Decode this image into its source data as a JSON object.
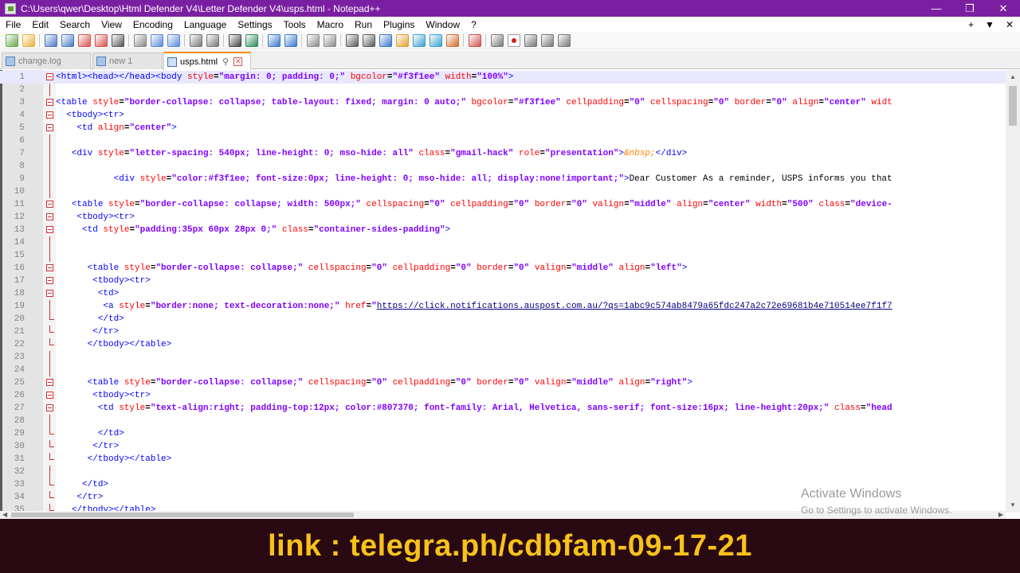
{
  "window": {
    "title": "C:\\Users\\qwer\\Desktop\\Html Defender V4\\Letter Defender V4\\usps.html - Notepad++",
    "controls": [
      "—",
      "❐",
      "✕"
    ]
  },
  "menu": {
    "items": [
      "File",
      "Edit",
      "Search",
      "View",
      "Encoding",
      "Language",
      "Settings",
      "Tools",
      "Macro",
      "Run",
      "Plugins",
      "Window",
      "?"
    ],
    "right": [
      "+",
      "▼",
      "✕"
    ]
  },
  "toolbar": {
    "icons": [
      "new-file-icon",
      "open-file-icon",
      "save-icon",
      "save-all-icon",
      "close-icon",
      "close-all-icon",
      "print-icon",
      "cut-icon",
      "copy-icon",
      "paste-icon",
      "undo-icon",
      "redo-icon",
      "find-icon",
      "replace-icon",
      "zoom-in-icon",
      "zoom-out-icon",
      "sync-vertical-icon",
      "sync-horizontal-icon",
      "word-wrap-icon",
      "show-all-chars-icon",
      "indent-guide-icon",
      "user-lang-icon",
      "doc-map-icon",
      "function-list-icon",
      "folder-workspace-icon",
      "monitoring-icon",
      "record-macro-icon",
      "stop-record-icon",
      "play-macro-icon",
      "run-macro-multiple-icon",
      "save-macro-icon"
    ]
  },
  "tabs": [
    {
      "label": "change.log",
      "active": false
    },
    {
      "label": "new 1",
      "active": false
    },
    {
      "label": "usps.html",
      "active": true
    }
  ],
  "editor": {
    "lines": [
      {
        "n": "1",
        "fold": "box",
        "html": "<span class='t'>&lt;html&gt;&lt;head&gt;&lt;/head&gt;&lt;body </span><span class='a'>style</span><span class='x'>=</span><span class='v'>\"margin: 0; padding: 0;\"</span><span class='t'> </span><span class='a'>bgcolor</span><span class='x'>=</span><span class='v'>\"#f3f1ee\"</span><span class='t'> </span><span class='a'>width</span><span class='x'>=</span><span class='v'>\"100%\"</span><span class='t'>&gt;</span>"
      },
      {
        "n": "2",
        "fold": "line",
        "html": ""
      },
      {
        "n": "3",
        "fold": "box",
        "html": "<span class='t'>&lt;table </span><span class='a'>style</span><span class='x'>=</span><span class='v'>\"border-collapse: collapse; table-layout: fixed; margin: 0 auto;\"</span><span class='t'> </span><span class='a'>bgcolor</span><span class='x'>=</span><span class='v'>\"#f3f1ee\"</span><span class='t'> </span><span class='a'>cellpadding</span><span class='x'>=</span><span class='v'>\"0\"</span><span class='t'> </span><span class='a'>cellspacing</span><span class='x'>=</span><span class='v'>\"0\"</span><span class='t'> </span><span class='a'>border</span><span class='x'>=</span><span class='v'>\"0\"</span><span class='t'> </span><span class='a'>align</span><span class='x'>=</span><span class='v'>\"center\"</span><span class='t'> </span><span class='a'>widt</span>"
      },
      {
        "n": "4",
        "fold": "box",
        "html": "  <span class='t'>&lt;tbody&gt;&lt;tr&gt;</span>"
      },
      {
        "n": "5",
        "fold": "box",
        "html": "    <span class='t'>&lt;td </span><span class='a'>align</span><span class='x'>=</span><span class='v'>\"center\"</span><span class='t'>&gt;</span>"
      },
      {
        "n": "6",
        "fold": "line",
        "html": ""
      },
      {
        "n": "7",
        "fold": "line",
        "html": "   <span class='t'>&lt;div </span><span class='a'>style</span><span class='x'>=</span><span class='v'>\"letter-spacing: 540px; line-height: 0; mso-hide: all\"</span><span class='t'> </span><span class='a'>class</span><span class='x'>=</span><span class='v'>\"gmail-hack\"</span><span class='t'> </span><span class='a'>role</span><span class='x'>=</span><span class='v'>\"presentation\"</span><span class='t'>&gt;</span><span class='e'>&amp;nbsp;</span><span class='t'>&lt;/div&gt;</span>"
      },
      {
        "n": "8",
        "fold": "line",
        "html": ""
      },
      {
        "n": "9",
        "fold": "line",
        "html": "           <span class='t'>&lt;div </span><span class='a'>style</span><span class='x'>=</span><span class='v'>\"color:#f3f1ee; font-size:0px; line-height: 0; mso-hide: all; display:none!important;\"</span><span class='t'>&gt;</span>Dear Customer As a reminder, USPS informs you that"
      },
      {
        "n": "10",
        "fold": "line",
        "html": ""
      },
      {
        "n": "11",
        "fold": "box",
        "html": "   <span class='t'>&lt;table </span><span class='a'>style</span><span class='x'>=</span><span class='v'>\"border-collapse: collapse; width: 500px;\"</span><span class='t'> </span><span class='a'>cellspacing</span><span class='x'>=</span><span class='v'>\"0\"</span><span class='t'> </span><span class='a'>cellpadding</span><span class='x'>=</span><span class='v'>\"0\"</span><span class='t'> </span><span class='a'>border</span><span class='x'>=</span><span class='v'>\"0\"</span><span class='t'> </span><span class='a'>valign</span><span class='x'>=</span><span class='v'>\"middle\"</span><span class='t'> </span><span class='a'>align</span><span class='x'>=</span><span class='v'>\"center\"</span><span class='t'> </span><span class='a'>width</span><span class='x'>=</span><span class='v'>\"500\"</span><span class='t'> </span><span class='a'>class</span><span class='x'>=</span><span class='v'>\"device-</span>"
      },
      {
        "n": "12",
        "fold": "box",
        "html": "    <span class='t'>&lt;tbody&gt;&lt;tr&gt;</span>"
      },
      {
        "n": "13",
        "fold": "box",
        "html": "     <span class='t'>&lt;td </span><span class='a'>style</span><span class='x'>=</span><span class='v'>\"padding:35px 60px 28px 0;\"</span><span class='t'> </span><span class='a'>class</span><span class='x'>=</span><span class='v'>\"container-sides-padding\"</span><span class='t'>&gt;</span>"
      },
      {
        "n": "14",
        "fold": "line",
        "html": ""
      },
      {
        "n": "15",
        "fold": "line",
        "html": ""
      },
      {
        "n": "16",
        "fold": "box",
        "html": "      <span class='t'>&lt;table </span><span class='a'>style</span><span class='x'>=</span><span class='v'>\"border-collapse: collapse;\"</span><span class='t'> </span><span class='a'>cellspacing</span><span class='x'>=</span><span class='v'>\"0\"</span><span class='t'> </span><span class='a'>cellpadding</span><span class='x'>=</span><span class='v'>\"0\"</span><span class='t'> </span><span class='a'>border</span><span class='x'>=</span><span class='v'>\"0\"</span><span class='t'> </span><span class='a'>valign</span><span class='x'>=</span><span class='v'>\"middle\"</span><span class='t'> </span><span class='a'>align</span><span class='x'>=</span><span class='v'>\"left\"</span><span class='t'>&gt;</span>"
      },
      {
        "n": "17",
        "fold": "box",
        "html": "       <span class='t'>&lt;tbody&gt;&lt;tr&gt;</span>"
      },
      {
        "n": "18",
        "fold": "box",
        "html": "        <span class='t'>&lt;td&gt;</span>"
      },
      {
        "n": "19",
        "fold": "line",
        "html": "         <span class='t'>&lt;a </span><span class='a'>style</span><span class='x'>=</span><span class='v'>\"border:none; text-decoration:none;\"</span><span class='t'> </span><span class='a'>href</span><span class='x'>=</span><span class='v'>\"</span><span class='u'>https://click.notifications.auspost.com.au/?qs=1abc9c574ab8479a65fdc247a2c72e69681b4e710514ee7f1f7</span>"
      },
      {
        "n": "20",
        "fold": "end",
        "html": "        <span class='t'>&lt;/td&gt;</span>"
      },
      {
        "n": "21",
        "fold": "end",
        "html": "       <span class='t'>&lt;/tr&gt;</span>"
      },
      {
        "n": "22",
        "fold": "end",
        "html": "      <span class='t'>&lt;/tbody&gt;&lt;/table&gt;</span>"
      },
      {
        "n": "23",
        "fold": "line",
        "html": ""
      },
      {
        "n": "24",
        "fold": "line",
        "html": ""
      },
      {
        "n": "25",
        "fold": "box",
        "html": "      <span class='t'>&lt;table </span><span class='a'>style</span><span class='x'>=</span><span class='v'>\"border-collapse: collapse;\"</span><span class='t'> </span><span class='a'>cellspacing</span><span class='x'>=</span><span class='v'>\"0\"</span><span class='t'> </span><span class='a'>cellpadding</span><span class='x'>=</span><span class='v'>\"0\"</span><span class='t'> </span><span class='a'>border</span><span class='x'>=</span><span class='v'>\"0\"</span><span class='t'> </span><span class='a'>valign</span><span class='x'>=</span><span class='v'>\"middle\"</span><span class='t'> </span><span class='a'>align</span><span class='x'>=</span><span class='v'>\"right\"</span><span class='t'>&gt;</span>"
      },
      {
        "n": "26",
        "fold": "box",
        "html": "       <span class='t'>&lt;tbody&gt;&lt;tr&gt;</span>"
      },
      {
        "n": "27",
        "fold": "box",
        "html": "        <span class='t'>&lt;td </span><span class='a'>style</span><span class='x'>=</span><span class='v'>\"text-align:right; padding-top:12px; color:#807370; font-family: Arial, Helvetica, sans-serif; font-size:16px; line-height:20px;\"</span><span class='t'> </span><span class='a'>class</span><span class='x'>=</span><span class='v'>\"head</span>"
      },
      {
        "n": "28",
        "fold": "line",
        "html": ""
      },
      {
        "n": "29",
        "fold": "end",
        "html": "        <span class='t'>&lt;/td&gt;</span>"
      },
      {
        "n": "30",
        "fold": "end",
        "html": "       <span class='t'>&lt;/tr&gt;</span>"
      },
      {
        "n": "31",
        "fold": "end",
        "html": "      <span class='t'>&lt;/tbody&gt;&lt;/table&gt;</span>"
      },
      {
        "n": "32",
        "fold": "line",
        "html": ""
      },
      {
        "n": "33",
        "fold": "end",
        "html": "     <span class='t'>&lt;/td&gt;</span>"
      },
      {
        "n": "34",
        "fold": "end",
        "html": "    <span class='t'>&lt;/tr&gt;</span>"
      },
      {
        "n": "35",
        "fold": "end",
        "html": "   <span class='t'>&lt;/tbody&gt;&lt;/table&gt;</span>"
      }
    ]
  },
  "watermark": {
    "line1": "Activate Windows",
    "line2": "Go to Settings to activate Windows."
  },
  "banner": {
    "text": "link : telegra.ph/cdbfam-09-17-21"
  },
  "colors": {
    "titlebar": "#7b1fa2",
    "tab_accent": "#fa8c00",
    "banner_bg": "#2a0a12",
    "banner_text": "#f7c21a"
  }
}
